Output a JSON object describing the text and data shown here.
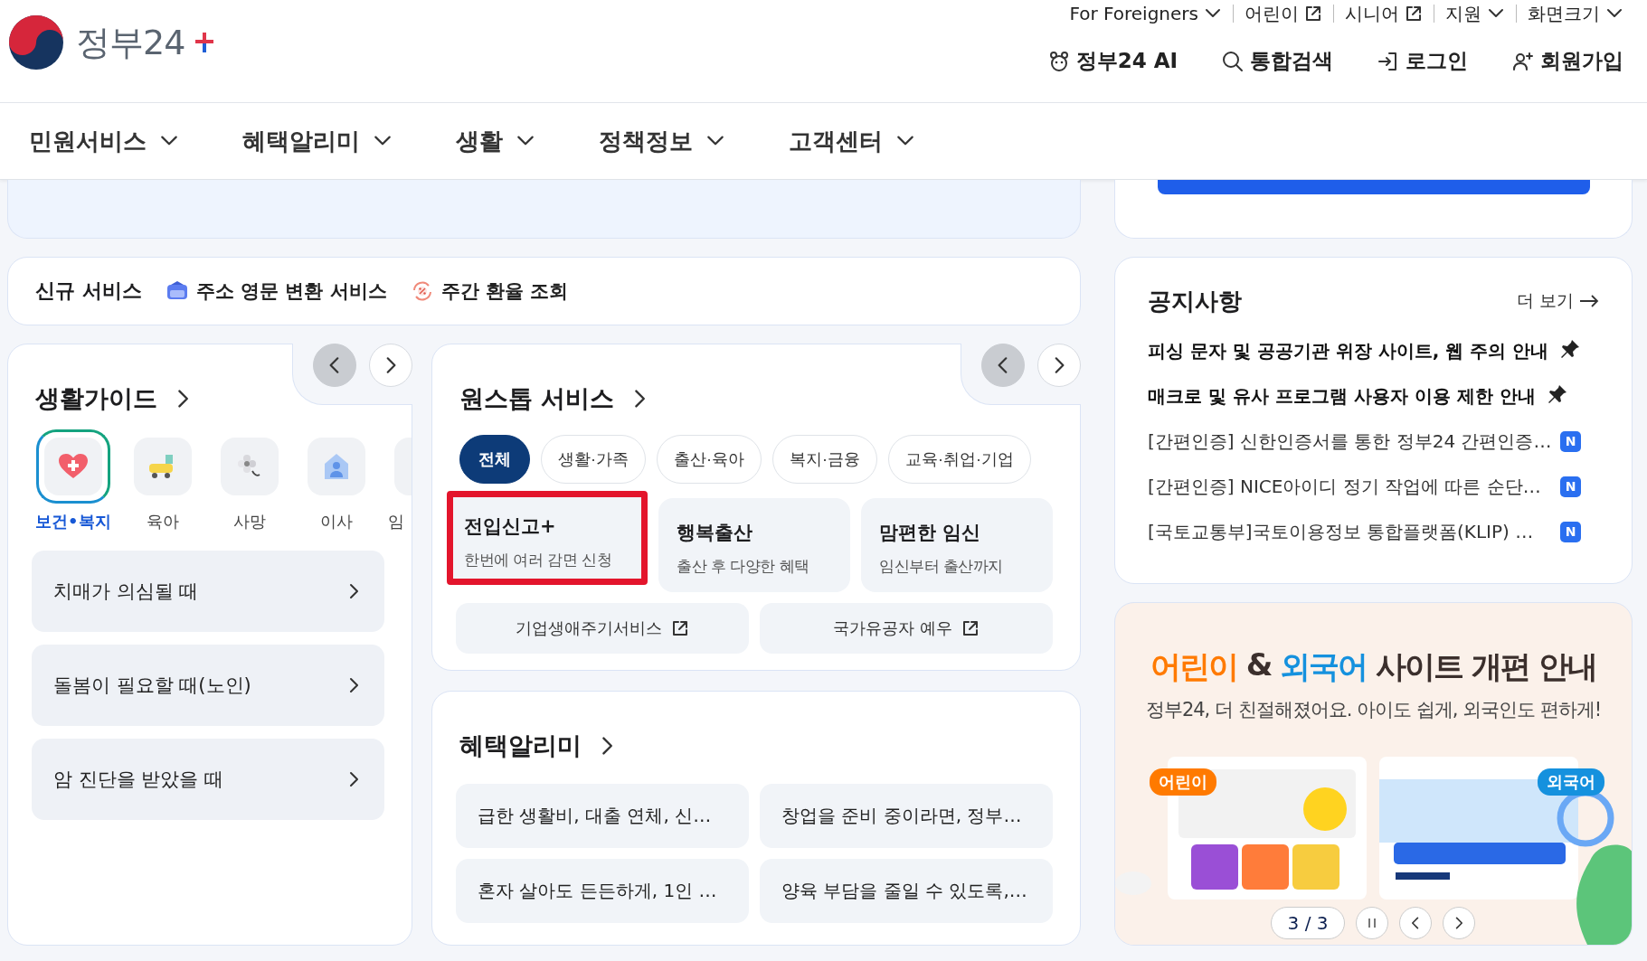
{
  "header": {
    "logo_text": "정부24",
    "utility_links": [
      {
        "label": "For Foreigners"
      },
      {
        "label": "어린이"
      },
      {
        "label": "시니어"
      },
      {
        "label": "지원"
      },
      {
        "label": "화면크기"
      }
    ],
    "actions": [
      {
        "label": "정부24 AI"
      },
      {
        "label": "통합검색"
      },
      {
        "label": "로그인"
      },
      {
        "label": "회원가입"
      }
    ]
  },
  "nav": [
    {
      "label": "민원서비스"
    },
    {
      "label": "혜택알리미"
    },
    {
      "label": "생활"
    },
    {
      "label": "정책정보"
    },
    {
      "label": "고객센터"
    }
  ],
  "new_services": {
    "title": "신규 서비스",
    "items": [
      {
        "label": "주소 영문 변환 서비스"
      },
      {
        "label": "주간 환율 조회"
      }
    ]
  },
  "life_guide": {
    "title": "생활가이드",
    "categories": [
      {
        "label": "보건•복지",
        "kind": "full",
        "selected": true
      },
      {
        "label": "육아",
        "kind": "full",
        "selected": false
      },
      {
        "label": "사망",
        "kind": "full",
        "selected": false
      },
      {
        "label": "이사",
        "kind": "full",
        "selected": false
      },
      {
        "label": "임",
        "kind": "partial",
        "selected": false
      }
    ],
    "items": [
      {
        "label": "치매가 의심될 때"
      },
      {
        "label": "돌봄이 필요할 때(노인)"
      },
      {
        "label": "암 진단을 받았을 때"
      }
    ]
  },
  "onestop": {
    "title": "원스톱 서비스",
    "filters": [
      {
        "label": "전체",
        "selected": true
      },
      {
        "label": "생활·가족",
        "selected": false
      },
      {
        "label": "출산·육아",
        "selected": false
      },
      {
        "label": "복지·금융",
        "selected": false
      },
      {
        "label": "교육·취업·기업",
        "selected": false
      }
    ],
    "services": [
      {
        "title": "전입신고+",
        "subtitle": "한번에 여러 감면 신청",
        "highlighted": true
      },
      {
        "title": "행복출산",
        "subtitle": "출산 후 다양한 혜택",
        "highlighted": false
      },
      {
        "title": "맘편한 임신",
        "subtitle": "임신부터 출산까지",
        "highlighted": false
      }
    ],
    "links": [
      {
        "label": "기업생애주기서비스"
      },
      {
        "label": "국가유공자 예우"
      }
    ]
  },
  "benefits": {
    "title": "혜택알리미",
    "items": [
      {
        "label": "급한 생활비, 대출 연체, 신…"
      },
      {
        "label": "창업을 준비 중이라면, 정부…"
      },
      {
        "label": "혼자 살아도 든든하게, 1인 …"
      },
      {
        "label": "양육 부담을 줄일 수 있도록,…"
      }
    ]
  },
  "notices": {
    "title": "공지사항",
    "more": "더 보기",
    "items": [
      {
        "text": "피싱 문자 및 공공기관 위장 사이트, 웹 주의 안내",
        "pinned": true,
        "new": false
      },
      {
        "text": "매크로 및 유사 프로그램 사용자 이용 제한 안내",
        "pinned": true,
        "new": false
      },
      {
        "text": "[간편인증] 신한인증서를 통한 정부24 간편인증…",
        "pinned": false,
        "new": true,
        "badge": "N"
      },
      {
        "text": "[간편인증] NICE아이디 정기 작업에 따른 순단…",
        "pinned": false,
        "new": true,
        "badge": "N"
      },
      {
        "text": "[국토교통부]국토이용정보 통합플랫폼(KLIP) …",
        "pinned": false,
        "new": true,
        "badge": "N"
      }
    ]
  },
  "banner": {
    "title_parts": [
      {
        "text": "어린이",
        "color": "#ff7a00"
      },
      {
        "text": "&",
        "color": "#3b2f2c"
      },
      {
        "text": "외국어",
        "color": "#1591de"
      },
      {
        "text": "사이트 개편 안내",
        "color": "#3b2f2c"
      }
    ],
    "subtitle": "정부24, 더 친절해졌어요. 아이도 쉽게, 외국인도 편하게!",
    "tags": [
      {
        "text": "어린이",
        "color": "#ff7a00"
      },
      {
        "text": "외국어",
        "color": "#1591de"
      }
    ],
    "counter": "3 / 3"
  }
}
